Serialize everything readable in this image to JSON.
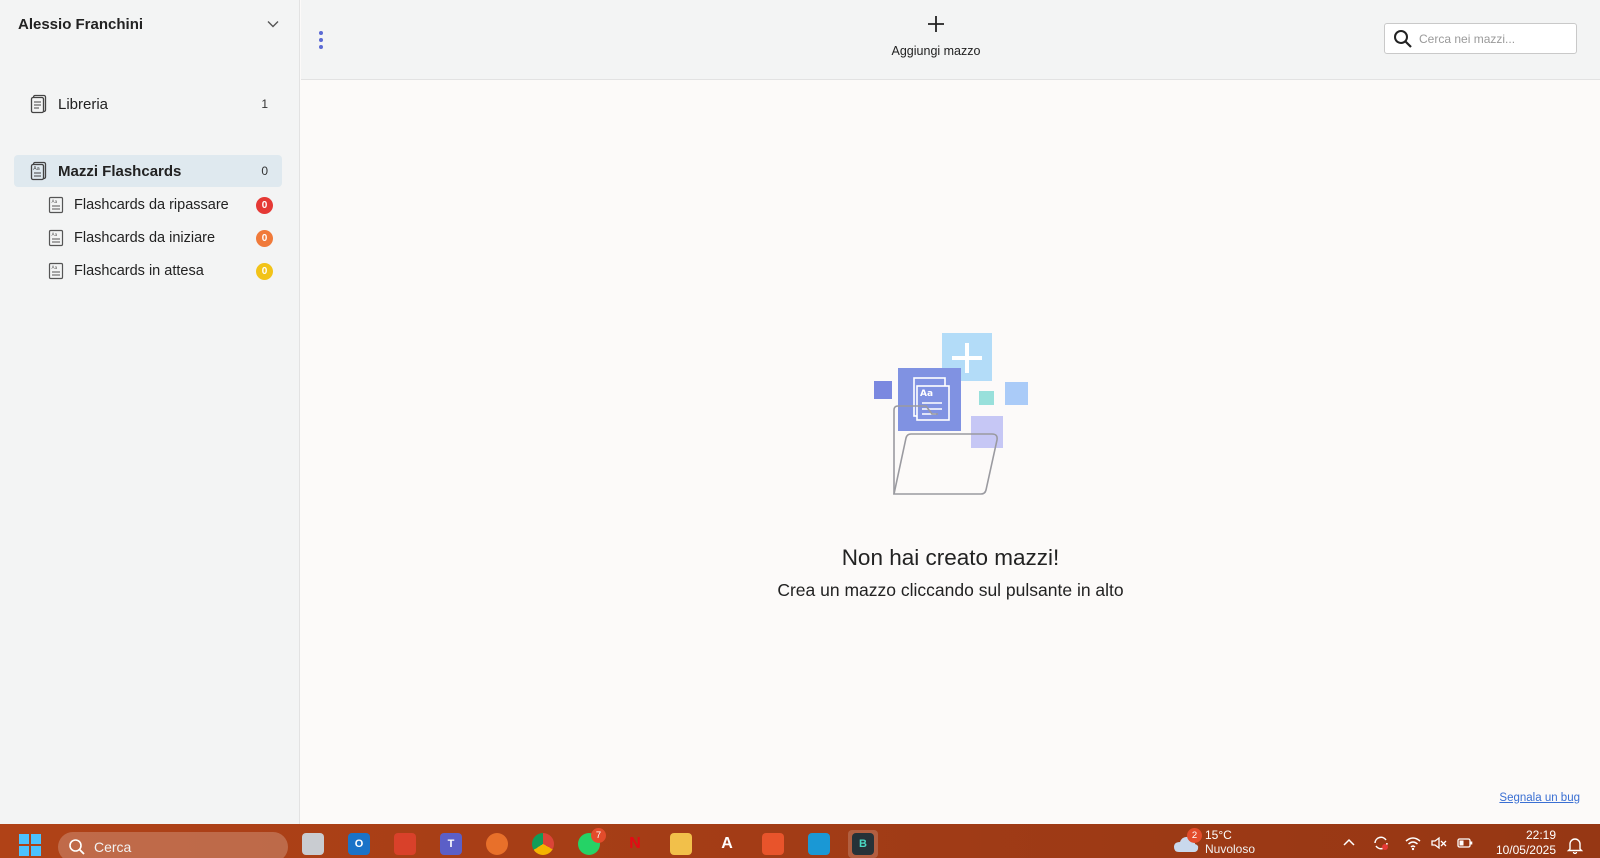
{
  "sidebar": {
    "user_name": "Alessio Franchini",
    "library": {
      "label": "Libreria",
      "count": "1"
    },
    "decks": {
      "label": "Mazzi Flashcards",
      "count": "0"
    },
    "sub_items": [
      {
        "label": "Flashcards da ripassare",
        "count": "0",
        "color": "#e53935"
      },
      {
        "label": "Flashcards da iniziare",
        "count": "0",
        "color": "#f07a3a"
      },
      {
        "label": "Flashcards in attesa",
        "count": "0",
        "color": "#f2c318"
      }
    ]
  },
  "toolbar": {
    "add_deck_label": "Aggiungi mazzo",
    "search_placeholder": "Cerca nei mazzi..."
  },
  "empty_state": {
    "title": "Non hai creato mazzi!",
    "subtitle": "Crea un mazzo cliccando sul pulsante in alto",
    "illustration_text": "Aa"
  },
  "footer": {
    "bug_link": "Segnala un bug"
  },
  "taskbar": {
    "search_label": "Cerca",
    "apps": [
      {
        "name": "task-view",
        "color": "#9aa0a6",
        "glyph": ""
      },
      {
        "name": "outlook",
        "color": "#1a73c8",
        "glyph": "O"
      },
      {
        "name": "app-red",
        "color": "#d9412a",
        "glyph": ""
      },
      {
        "name": "teams",
        "color": "#5b5fc7",
        "glyph": "T"
      },
      {
        "name": "firefox",
        "color": "#e8702a",
        "glyph": ""
      },
      {
        "name": "chrome",
        "color": "#2f8f4e",
        "glyph": ""
      },
      {
        "name": "whatsapp",
        "color": "#25d366",
        "glyph": "",
        "badge": "7"
      },
      {
        "name": "netflix",
        "color": "#c4151c",
        "glyph": "N"
      },
      {
        "name": "file-explorer",
        "color": "#f2c04a",
        "glyph": ""
      },
      {
        "name": "acrobat",
        "color": "#b82a2a",
        "glyph": "A"
      },
      {
        "name": "brave",
        "color": "#e8542b",
        "glyph": ""
      },
      {
        "name": "prime-video",
        "color": "#1a98d5",
        "glyph": ""
      },
      {
        "name": "flashcards-app",
        "color": "#263238",
        "glyph": "B"
      }
    ],
    "weather": {
      "badge": "2",
      "temp": "15°C",
      "condition": "Nuvoloso"
    },
    "clock": {
      "time": "22:19",
      "date": "10/05/2025"
    }
  }
}
